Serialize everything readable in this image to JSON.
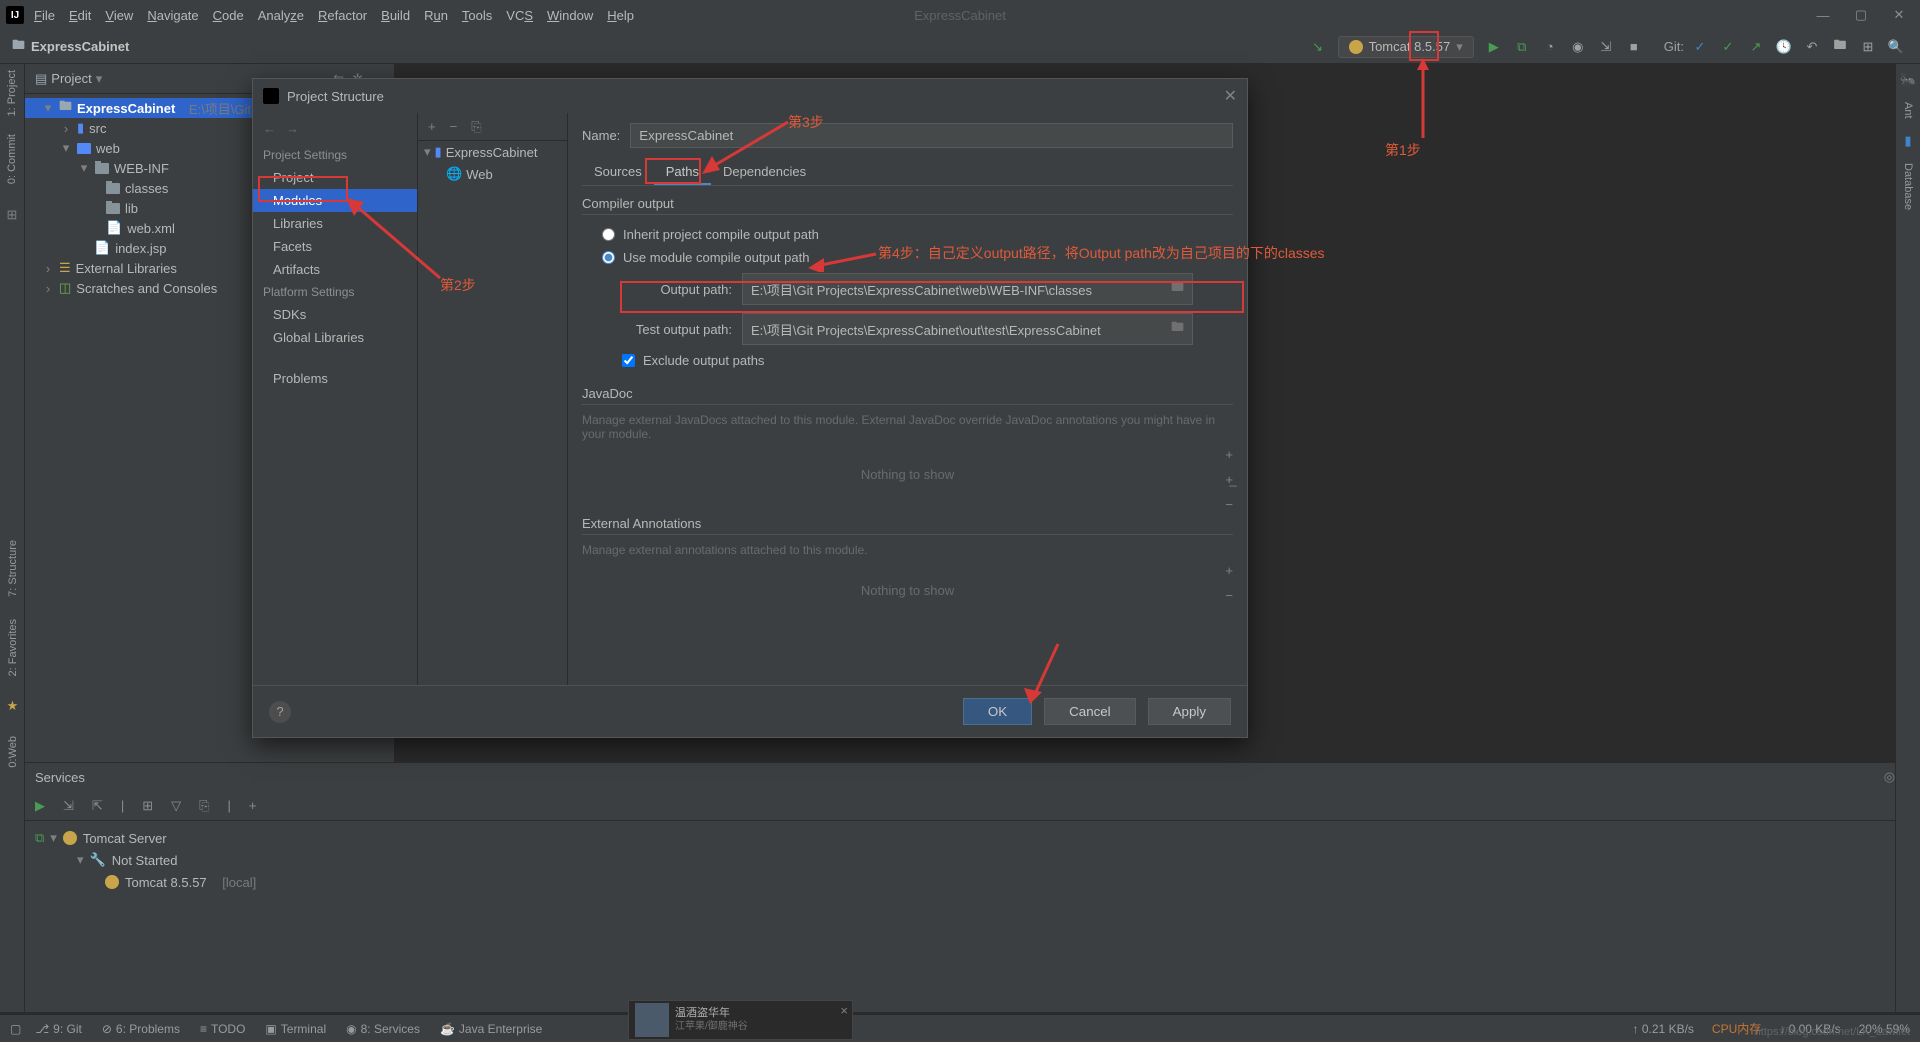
{
  "app_name": "ExpressCabinet",
  "menu": [
    "File",
    "Edit",
    "View",
    "Navigate",
    "Code",
    "Analyze",
    "Refactor",
    "Build",
    "Run",
    "Tools",
    "VCS",
    "Window",
    "Help"
  ],
  "breadcrumb": "ExpressCabinet",
  "run_config": "Tomcat 8.5.57",
  "git_label": "Git:",
  "left_gutter": [
    "1: Project",
    "0: Commit"
  ],
  "right_gutter": [
    "Ant",
    "Database"
  ],
  "project_view_label": "Project",
  "tree": {
    "root": "ExpressCabinet",
    "root_path": "E:\\项目\\Git Proje",
    "src": "src",
    "web": "web",
    "webinf": "WEB-INF",
    "classes": "classes",
    "lib": "lib",
    "webxml": "web.xml",
    "indexjsp": "index.jsp",
    "ext": "External Libraries",
    "scratch": "Scratches and Consoles"
  },
  "left_gutter_lower": [
    "7: Structure",
    "2: Favorites",
    "0:Web"
  ],
  "services": {
    "title": "Services",
    "tomcat_server": "Tomcat Server",
    "not_started": "Not Started",
    "tomcat_item": "Tomcat 8.5.57",
    "tomcat_local": "[local]"
  },
  "bottom_tabs": [
    "9: Git",
    "6: Problems",
    "TODO",
    "Terminal",
    "8: Services",
    "Java Enterprise"
  ],
  "status_net": "0.21 KB/s",
  "status_net2": "0.00 KB/s",
  "status_cpu": "CPU内存",
  "status_pct": "20%    59%",
  "dialog": {
    "title": "Project Structure",
    "settings_hdr": "Project Settings",
    "settings": [
      "Project",
      "Modules",
      "Libraries",
      "Facets",
      "Artifacts"
    ],
    "platform_hdr": "Platform Settings",
    "platform": [
      "SDKs",
      "Global Libraries"
    ],
    "problems": "Problems",
    "module": "ExpressCabinet",
    "module_web": "Web",
    "name_lbl": "Name:",
    "name_val": "ExpressCabinet",
    "tabs": [
      "Sources",
      "Paths",
      "Dependencies"
    ],
    "compiler_hdr": "Compiler output",
    "radio1": "Inherit project compile output path",
    "radio2": "Use module compile output path",
    "outpath_lbl": "Output path:",
    "outpath_val": "E:\\项目\\Git Projects\\ExpressCabinet\\web\\WEB-INF\\classes",
    "testpath_lbl": "Test output path:",
    "testpath_val": "E:\\项目\\Git Projects\\ExpressCabinet\\out\\test\\ExpressCabinet",
    "exclude_lbl": "Exclude output paths",
    "javadoc_hdr": "JavaDoc",
    "javadoc_desc": "Manage external JavaDocs attached to this module. External JavaDoc override JavaDoc annotations you might have in your module.",
    "nothing": "Nothing to show",
    "ext_hdr": "External Annotations",
    "ext_desc": "Manage external annotations attached to this module.",
    "ok": "OK",
    "cancel": "Cancel",
    "apply": "Apply"
  },
  "annotations": {
    "step1": "第1步",
    "step2": "第2步",
    "step3": "第3步",
    "step4": "第4步：自己定义output路径，将Output path改为自己项目的下的classes"
  },
  "music": {
    "title": "温酒盗华年",
    "sub": "江苹果/御鹿神谷"
  },
  "watermark": "https://blog.csdn.net/LK_Lawliet"
}
